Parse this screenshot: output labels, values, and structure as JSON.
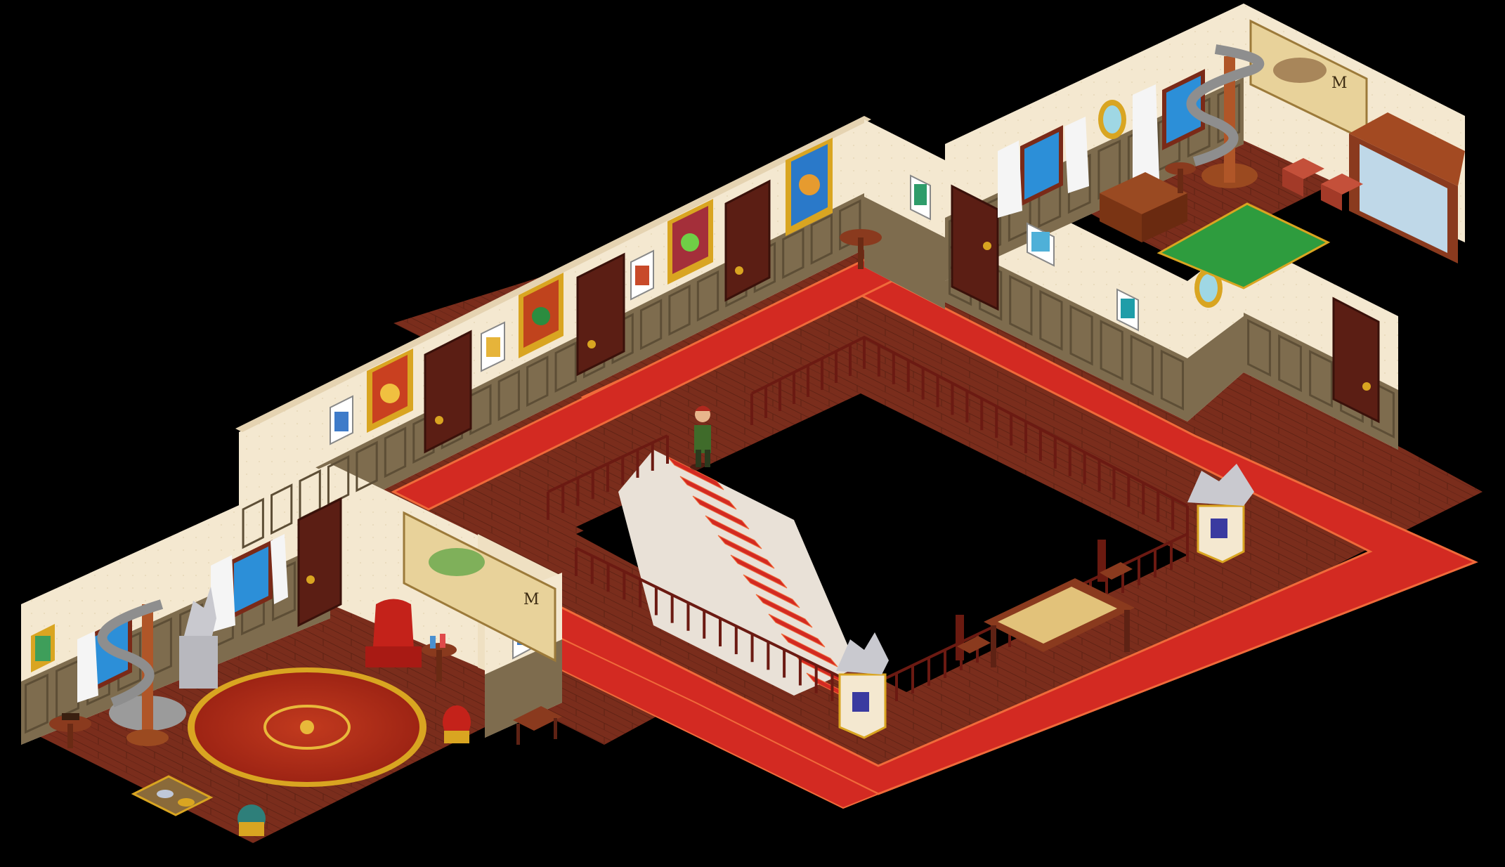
{
  "scene": {
    "name": "isometric-mansion-hallway",
    "colors": {
      "background": "#000000",
      "wall_cream": "#F4E8D0",
      "wall_cream_shade": "#E5D3B1",
      "wainscot": "#7E6C4E",
      "wainscot_dark": "#5D4E36",
      "wood_floor": "#7A2D1C",
      "wood_floor_dark": "#5E2214",
      "carpet_red": "#D32A22",
      "carpet_trim": "#F06A3A",
      "door": "#5B1E14",
      "gold": "#D9A521",
      "railing": "#6B1A12",
      "green_rug": "#2E9C3E",
      "stone": "#C9C9CF"
    },
    "objects": {
      "avatar": "avatar-player",
      "statues": [
        "dragon-statue-left-room",
        "dragon-statue-center",
        "dragon-statue-right"
      ],
      "maps": [
        "framed-map-left",
        "framed-map-right"
      ],
      "map_left_text": "M",
      "map_right_text": "M"
    }
  }
}
